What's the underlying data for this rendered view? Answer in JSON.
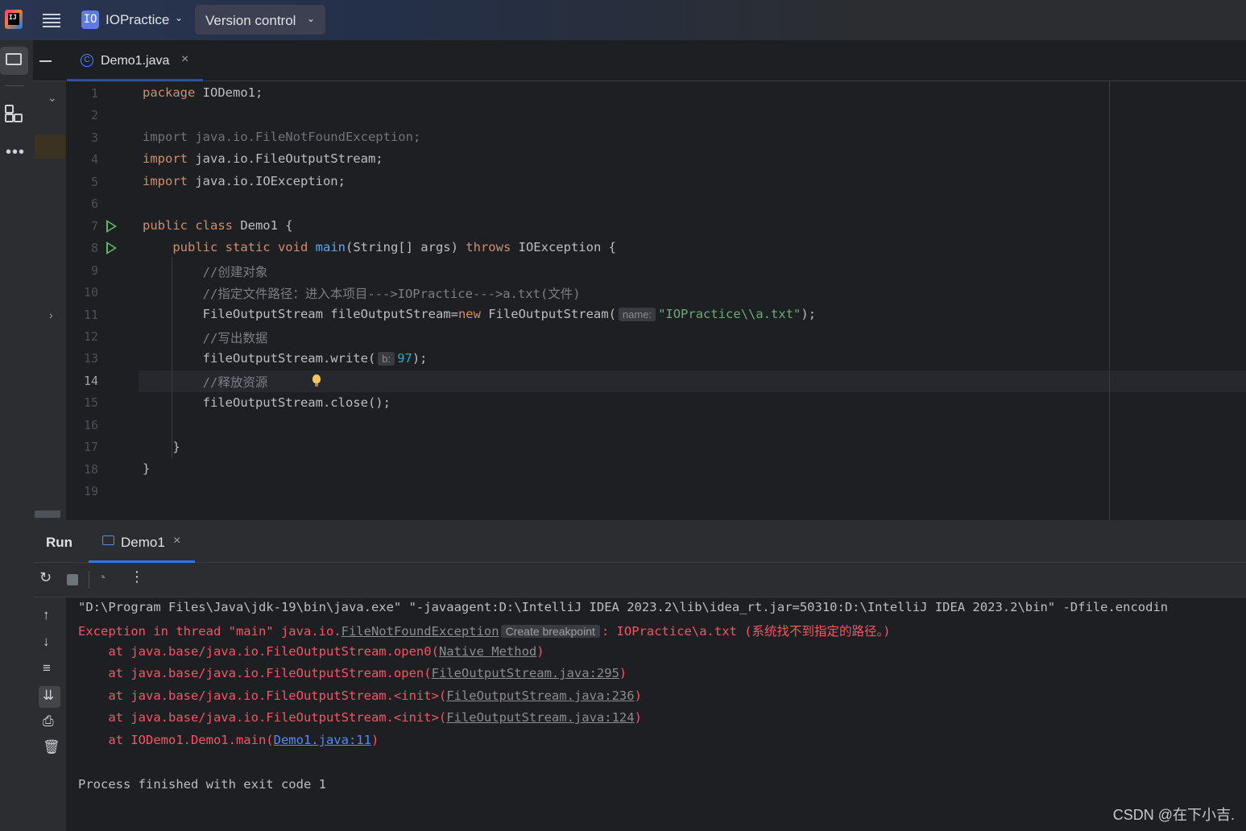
{
  "titlebar": {
    "project_badge": "IO",
    "project_name": "IOPractice",
    "version_control": "Version control"
  },
  "tab": {
    "label": "Demo1.java",
    "icon": "class-icon",
    "close": "×"
  },
  "editor": {
    "current_line": 14,
    "lines": [
      {
        "n": "1"
      },
      {
        "n": "2"
      },
      {
        "n": "3"
      },
      {
        "n": "4"
      },
      {
        "n": "5"
      },
      {
        "n": "6"
      },
      {
        "n": "7"
      },
      {
        "n": "8"
      },
      {
        "n": "9"
      },
      {
        "n": "10"
      },
      {
        "n": "11"
      },
      {
        "n": "12"
      },
      {
        "n": "13"
      },
      {
        "n": "14"
      },
      {
        "n": "15"
      },
      {
        "n": "16"
      },
      {
        "n": "17"
      },
      {
        "n": "18"
      },
      {
        "n": "19"
      }
    ],
    "code": {
      "l1_kw": "package",
      "l1_rest": " IODemo1;",
      "l3": "import java.io.FileNotFoundException;",
      "l4_kw": "import",
      "l4_rest": " java.io.FileOutputStream;",
      "l5_kw": "import",
      "l5_rest": " java.io.IOException;",
      "l7_kw": "public class",
      "l7_rest": " Demo1 {",
      "l8_kw1": "public static void",
      "l8_fn": "main",
      "l8_mid": "(String[] args) ",
      "l8_kw2": "throws",
      "l8_rest": " IOException {",
      "l9": "//创建对象",
      "l10": "//指定文件路径：进入本项目--->IOPractice--->a.txt(文件)",
      "l11_a": "FileOutputStream fileOutputStream=",
      "l11_kw": "new",
      "l11_b": " FileOutputStream(",
      "l11_hint": "name:",
      "l11_str": "\"IOPractice\\\\a.txt\"",
      "l11_end": ");",
      "l12": "//写出数据",
      "l13_a": "fileOutputStream.write(",
      "l13_hint": "b:",
      "l13_num": "97",
      "l13_end": ");",
      "l14": "//释放资源",
      "l15": "fileOutputStream.close();",
      "l17": "}",
      "l18": "}"
    }
  },
  "run": {
    "title": "Run",
    "tab_label": "Demo1",
    "tab_close": "×",
    "console": {
      "cmd": "\"D:\\Program Files\\Java\\jdk-19\\bin\\java.exe\" \"-javaagent:D:\\IntelliJ IDEA 2023.2\\lib\\idea_rt.jar=50310:D:\\IntelliJ IDEA 2023.2\\bin\" -Dfile.encodin",
      "exc_prefix": "Exception in thread \"main\" java.io.",
      "exc_link": "FileNotFoundException",
      "exc_badge": "Create breakpoint",
      "exc_suffix": ": IOPractice\\a.txt (系统找不到指定的路径。)",
      "st1_a": "    at java.base/java.io.FileOutputStream.open0(",
      "st1_link": "Native Method",
      "st1_b": ")",
      "st2_a": "    at java.base/java.io.FileOutputStream.open(",
      "st2_link": "FileOutputStream.java:295",
      "st2_b": ")",
      "st3_a": "    at java.base/java.io.FileOutputStream.<init>(",
      "st3_link": "FileOutputStream.java:236",
      "st3_b": ")",
      "st4_a": "    at java.base/java.io.FileOutputStream.<init>(",
      "st4_link": "FileOutputStream.java:124",
      "st4_b": ")",
      "st5_a": "    at IODemo1.Demo1.main(",
      "st5_link": "Demo1.java:11",
      "st5_b": ")",
      "finished": "Process finished with exit code 1"
    }
  },
  "watermark": "CSDN @在下小吉."
}
